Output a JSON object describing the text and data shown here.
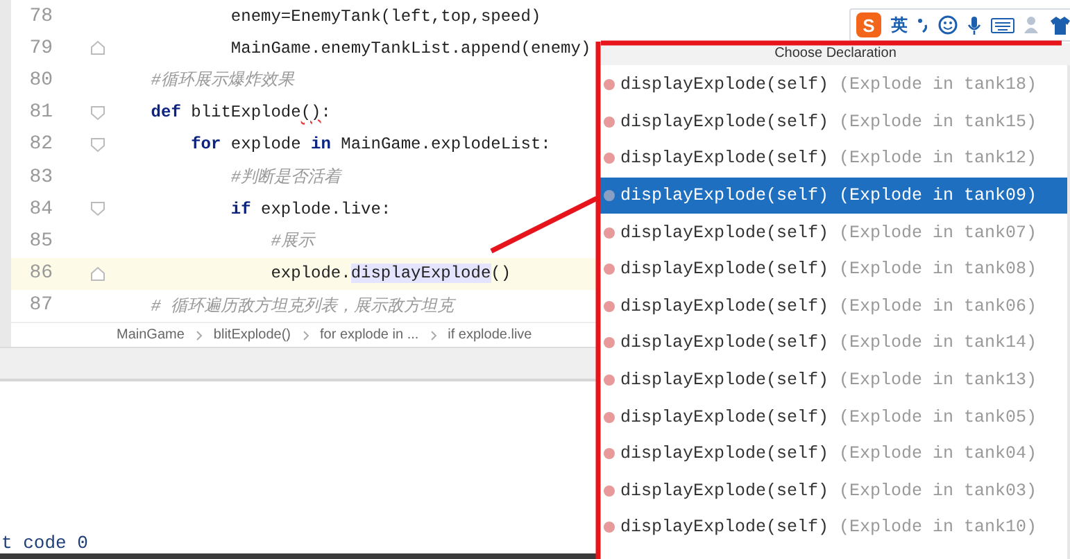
{
  "editor": {
    "lines": [
      {
        "number": "78",
        "fold_open": false,
        "fold_close": false,
        "current": false,
        "tokens": [
          {
            "kind": "plain",
            "text": "            enemy=EnemyTank(left,top,speed)"
          }
        ]
      },
      {
        "number": "79",
        "fold_open": false,
        "fold_close": true,
        "current": false,
        "tokens": [
          {
            "kind": "plain",
            "text": "            MainGame.enemyTankList.append(enemy)"
          }
        ]
      },
      {
        "number": "80",
        "fold_open": false,
        "fold_close": false,
        "current": false,
        "tokens": [
          {
            "kind": "comment",
            "text": "    #循环展示爆炸效果"
          }
        ]
      },
      {
        "number": "81",
        "fold_open": true,
        "fold_close": false,
        "current": false,
        "tokens": [
          {
            "kind": "keyword",
            "text": "    def"
          },
          {
            "kind": "plain",
            "text": " blitExplode"
          },
          {
            "kind": "warning",
            "text": "()"
          },
          {
            "kind": "plain",
            "text": ":"
          }
        ]
      },
      {
        "number": "82",
        "fold_open": true,
        "fold_close": false,
        "current": false,
        "tokens": [
          {
            "kind": "keyword",
            "text": "        for"
          },
          {
            "kind": "plain",
            "text": " explode "
          },
          {
            "kind": "keyword",
            "text": "in"
          },
          {
            "kind": "plain",
            "text": " MainGame.explodeList:"
          }
        ]
      },
      {
        "number": "83",
        "fold_open": false,
        "fold_close": false,
        "current": false,
        "tokens": [
          {
            "kind": "comment",
            "text": "            #判断是否活着"
          }
        ]
      },
      {
        "number": "84",
        "fold_open": true,
        "fold_close": false,
        "current": false,
        "tokens": [
          {
            "kind": "keyword",
            "text": "            if"
          },
          {
            "kind": "plain",
            "text": " explode.live:"
          }
        ]
      },
      {
        "number": "85",
        "fold_open": false,
        "fold_close": false,
        "current": false,
        "tokens": [
          {
            "kind": "comment",
            "text": "                #展示"
          }
        ]
      },
      {
        "number": "86",
        "fold_open": false,
        "fold_close": true,
        "current": true,
        "tokens": [
          {
            "kind": "plain",
            "text": "                explode."
          },
          {
            "kind": "highlight",
            "text": "displayExplode"
          },
          {
            "kind": "plain",
            "text": "()"
          }
        ]
      },
      {
        "number": "87",
        "fold_open": false,
        "fold_close": false,
        "current": false,
        "tokens": [
          {
            "kind": "comment",
            "text": "    # 循环遍历敌方坦克列表，展示敌方坦克"
          }
        ]
      }
    ]
  },
  "breadcrumbs": [
    "MainGame",
    "blitExplode()",
    "for explode in ...",
    "if explode.live"
  ],
  "output": {
    "text": "t code 0"
  },
  "ime_bar": {
    "logo": "S",
    "mode": "英"
  },
  "popup": {
    "title": "Choose Declaration",
    "items": [
      {
        "name": "displayExplode(self)",
        "location": "(Explode in tank18)",
        "selected": false
      },
      {
        "name": "displayExplode(self)",
        "location": "(Explode in tank15)",
        "selected": false
      },
      {
        "name": "displayExplode(self)",
        "location": "(Explode in tank12)",
        "selected": false
      },
      {
        "name": "displayExplode(self)",
        "location": "(Explode in tank09)",
        "selected": true
      },
      {
        "name": "displayExplode(self)",
        "location": "(Explode in tank07)",
        "selected": false
      },
      {
        "name": "displayExplode(self)",
        "location": "(Explode in tank08)",
        "selected": false
      },
      {
        "name": "displayExplode(self)",
        "location": "(Explode in tank06)",
        "selected": false
      },
      {
        "name": "displayExplode(self)",
        "location": "(Explode in tank14)",
        "selected": false
      },
      {
        "name": "displayExplode(self)",
        "location": "(Explode in tank13)",
        "selected": false
      },
      {
        "name": "displayExplode(self)",
        "location": "(Explode in tank05)",
        "selected": false
      },
      {
        "name": "displayExplode(self)",
        "location": "(Explode in tank04)",
        "selected": false
      },
      {
        "name": "displayExplode(self)",
        "location": "(Explode in tank03)",
        "selected": false
      },
      {
        "name": "displayExplode(self)",
        "location": "(Explode in tank10)",
        "selected": false
      }
    ]
  }
}
